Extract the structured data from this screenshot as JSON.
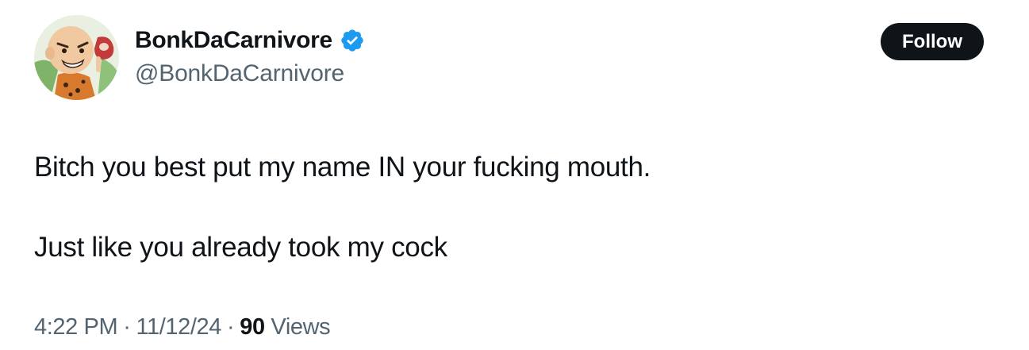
{
  "author": {
    "display_name": "BonkDaCarnivore",
    "handle": "@BonkDaCarnivore",
    "verified": true,
    "verified_color": "#1d9bf0"
  },
  "actions": {
    "follow_label": "Follow"
  },
  "tweet": {
    "lines": [
      "Bitch you best put my name IN your fucking mouth.",
      "Just like you already took my cock"
    ]
  },
  "meta": {
    "time": "4:22 PM",
    "separator": "·",
    "date": "11/12/24",
    "views_count": "90",
    "views_label": "Views"
  },
  "colors": {
    "text": "#0f1419",
    "secondary": "#536471",
    "button_bg": "#0f1419",
    "button_text": "#ffffff"
  },
  "icons": {
    "verified": "verified-badge-icon",
    "avatar": "caveman-eating-meat-avatar"
  }
}
